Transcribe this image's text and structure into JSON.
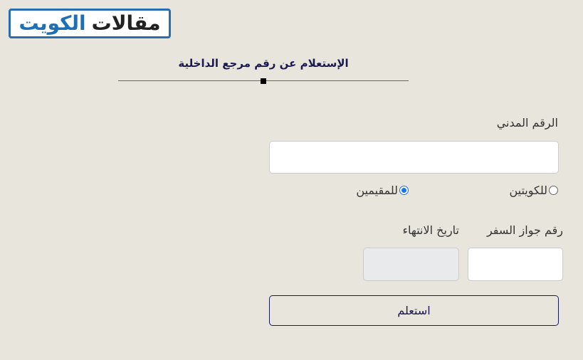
{
  "logo": {
    "word_black": "مقالات",
    "word_blue": "الكويت"
  },
  "page_title": "الإستعلام عن رقم مرجع الداخلية",
  "form": {
    "civil_id_label": "الرقم المدني",
    "civil_id_value": "",
    "nationality_options": [
      {
        "label": "للكويتين",
        "selected": false
      },
      {
        "label": "للمقيمين",
        "selected": true
      }
    ],
    "passport_label": "رقم جواز السفر",
    "passport_value": "",
    "expiry_label": "تاريخ الانتهاء",
    "expiry_value": "",
    "submit_label": "استعلم"
  },
  "colors": {
    "background": "#e8e5dd",
    "brand_blue": "#1e6fb5",
    "title_navy": "#1a1a4e",
    "radio_checked": "#1a73e8",
    "disabled_input": "#e8eaec"
  }
}
